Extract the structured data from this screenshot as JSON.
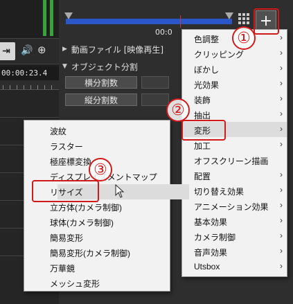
{
  "colors": {
    "annotation_red": "#d01a1a",
    "menu_bg": "#f2f2f2",
    "slider_blue": "#2b56c8",
    "meter_green": "#3aa23a"
  },
  "left": {
    "skip_end_glyph": "⇥",
    "speaker_glyph": "🔊",
    "zoom_glyph": "⊕",
    "timecode": "00:00:23.4"
  },
  "header": {
    "time_partial": "00:0",
    "add_glyph": "+"
  },
  "sections": {
    "video_file": "動画ファイル [映像再生]",
    "object_split": "オブジェクト分割",
    "horizontal_split": "横分割数",
    "vertical_split": "縦分割数"
  },
  "main_menu": {
    "items": [
      {
        "label": "色調整",
        "has_submenu": true
      },
      {
        "label": "クリッピング",
        "has_submenu": true
      },
      {
        "label": "ぼかし",
        "has_submenu": true
      },
      {
        "label": "光効果",
        "has_submenu": true
      },
      {
        "label": "装飾",
        "has_submenu": true
      },
      {
        "label": "抽出",
        "has_submenu": true
      },
      {
        "label": "変形",
        "has_submenu": true
      },
      {
        "label": "加工",
        "has_submenu": true
      },
      {
        "label": "オフスクリーン描画",
        "has_submenu": false
      },
      {
        "label": "配置",
        "has_submenu": true
      },
      {
        "label": "切り替え効果",
        "has_submenu": true
      },
      {
        "label": "アニメーション効果",
        "has_submenu": true
      },
      {
        "label": "基本効果",
        "has_submenu": true
      },
      {
        "label": "カメラ制御",
        "has_submenu": true
      },
      {
        "label": "音声効果",
        "has_submenu": true
      },
      {
        "label": "Utsbox",
        "has_submenu": true
      }
    ]
  },
  "sub_menu": {
    "items": [
      {
        "label": "波紋"
      },
      {
        "label": "ラスター"
      },
      {
        "label": "極座標変換"
      },
      {
        "label": "ディスプレイスメントマップ"
      },
      {
        "label": "リサイズ"
      },
      {
        "label": "立方体(カメラ制御)"
      },
      {
        "label": "球体(カメラ制御)"
      },
      {
        "label": "簡易変形"
      },
      {
        "label": "簡易変形(カメラ制御)"
      },
      {
        "label": "万華鏡"
      },
      {
        "label": "メッシュ変形"
      }
    ]
  },
  "annotations": {
    "step1": "①",
    "step2": "②",
    "step3": "③"
  },
  "chevron_glyph": "›"
}
